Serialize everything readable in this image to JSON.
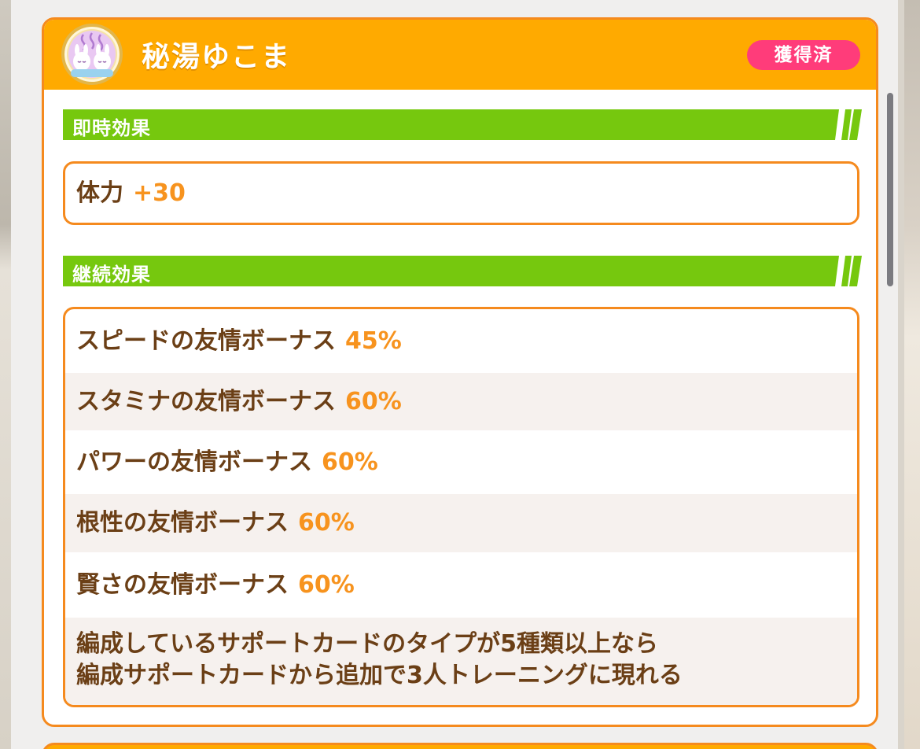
{
  "card": {
    "title": "秘湯ゆこま",
    "badge": "獲得済",
    "avatar_icon": "yukoma-bunny-icon"
  },
  "immediate": {
    "section_label": "即時効果",
    "effects": [
      {
        "label": "体力",
        "value": "+30"
      }
    ]
  },
  "continuous": {
    "section_label": "継続効果",
    "effects": [
      {
        "label": "スピードの友情ボーナス",
        "value": "45%"
      },
      {
        "label": "スタミナの友情ボーナス",
        "value": "60%"
      },
      {
        "label": "パワーの友情ボーナス",
        "value": "60%"
      },
      {
        "label": "根性の友情ボーナス",
        "value": "60%"
      },
      {
        "label": "賢さの友情ボーナス",
        "value": "60%"
      }
    ],
    "note_lines": [
      "編成しているサポートカードのタイプが5種類以上なら",
      "編成サポートカードから追加で3人トレーニングに現れる"
    ]
  },
  "colors": {
    "header": "#ffaa00",
    "border": "#f58a1e",
    "section_bar": "#76c80e",
    "badge": "#ff3c7a",
    "text": "#6b3f16",
    "value": "#f7931e"
  }
}
